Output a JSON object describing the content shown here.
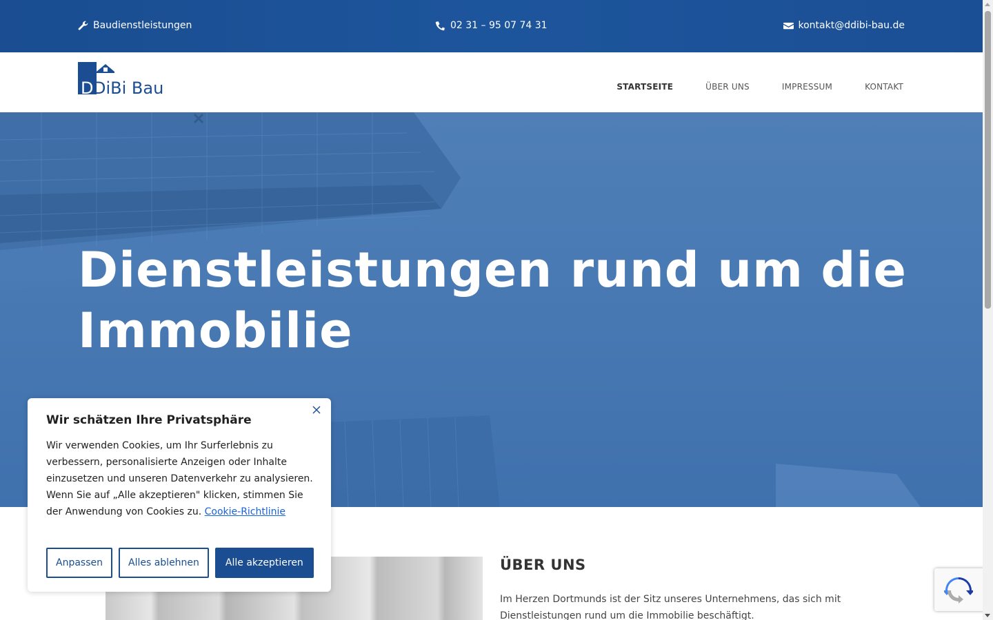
{
  "topbar": {
    "services": "Baudienstleistungen",
    "phone": "02 31 – 95 07 74 31",
    "email": "kontakt@ddibi-bau.de",
    "background": "#1a4d91"
  },
  "logo": {
    "text": "DDiBi Bau",
    "color": "#1a4d91"
  },
  "nav": {
    "items": [
      {
        "label": "STARTSEITE",
        "active": true
      },
      {
        "label": "ÜBER UNS",
        "active": false
      },
      {
        "label": "IMPRESSUM",
        "active": false
      },
      {
        "label": "KONTAKT",
        "active": false
      }
    ]
  },
  "hero": {
    "title": "Dienstleistungen rund um die Immobilie",
    "overlay_color": "#3f71ae"
  },
  "about": {
    "title": "ÜBER UNS",
    "text": "Im Herzen Dortmunds ist der Sitz unseres Unternehmens, das sich mit Dienstleistungen rund um die Immobilie beschäftigt."
  },
  "cookie": {
    "title": "Wir schätzen Ihre Privatsphäre",
    "message": "Wir verwenden Cookies, um Ihr Surferlebnis zu verbessern, personalisierte Anzeigen oder Inhalte einzusetzen und unseren Datenverkehr zu analysieren. Wenn Sie auf „Alle akzeptieren\" klicken, stimmen Sie der Anwendung von Cookies zu.",
    "policy_link": "Cookie-Richtlinie",
    "customize_label": "Anpassen",
    "reject_label": "Alles ablehnen",
    "accept_label": "Alle akzeptieren",
    "accent": "#1a4d91"
  },
  "icons": {
    "services": "wrench-icon",
    "phone": "phone-icon",
    "email": "envelope-icon",
    "close": "close-icon",
    "recaptcha": "recaptcha-icon"
  }
}
